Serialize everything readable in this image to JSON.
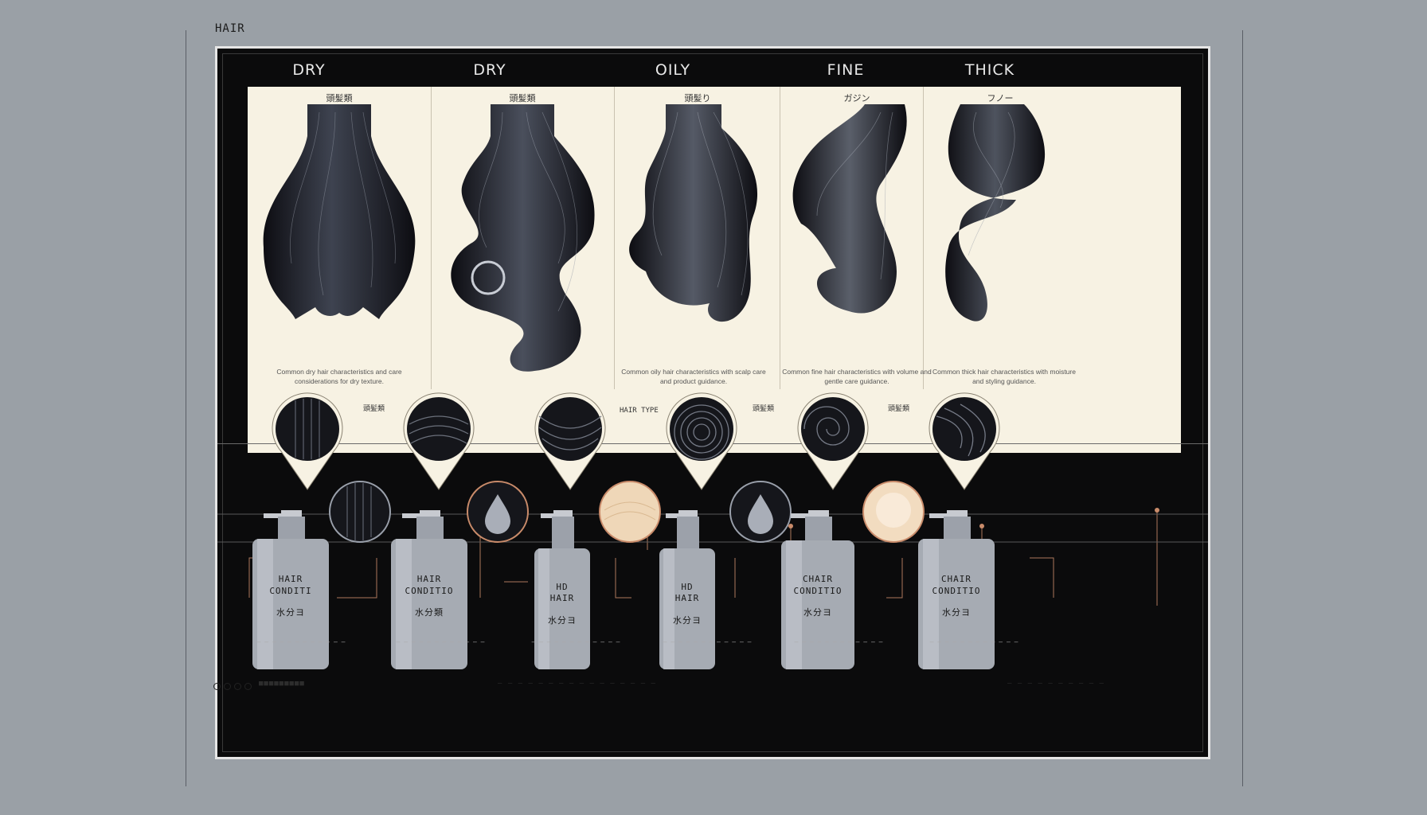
{
  "header": {
    "corner_tag": "HAIR"
  },
  "types": [
    {
      "title": "DRY",
      "sublabel": "頭髪類",
      "desc": "Common dry hair characteristics and care considerations for dry texture."
    },
    {
      "title": "DRY",
      "sublabel": "頭髪類",
      "desc": ""
    },
    {
      "title": "OILY",
      "sublabel": "頭髪り",
      "desc": "Common oily hair characteristics with scalp care and product guidance."
    },
    {
      "title": "FINE",
      "sublabel": "ガジン",
      "desc": "Common fine hair characteristics with volume and gentle care guidance."
    },
    {
      "title": "THICK",
      "sublabel": "フノー",
      "desc": "Common thick hair characteristics with moisture and styling guidance."
    }
  ],
  "swatch_labels": [
    "頭髪類",
    "HAIR TYPE",
    "頭髪類",
    "頭髪類"
  ],
  "bottles": [
    {
      "line1": "HAIR",
      "line2": "CONDITI",
      "line3": "水分ヨ"
    },
    {
      "line1": "HAIR",
      "line2": "CONDITIO",
      "line3": "水分類"
    },
    {
      "line1": "HD",
      "line2": "HAIR",
      "line3": "水分ヨ"
    },
    {
      "line1": "HD",
      "line2": "HAIR",
      "line3": "水分ヨ"
    },
    {
      "line1": "CHAIR",
      "line2": "CONDITIO",
      "line3": "水分ヨ"
    },
    {
      "line1": "CHAIR",
      "line2": "CONDITIO",
      "line3": "水分ヨ"
    }
  ],
  "footnote": "— — — — — — — — — — — —",
  "footer": {
    "left": "■■■■■■■■■",
    "center": "— — — — — — — — — — — — — — — —",
    "right": "— — — — — — — — — —"
  },
  "colors": {
    "panel": "#f7f2e3",
    "poster": "#0b0b0c",
    "bg": "#9aa0a6",
    "copper": "#c98b6a"
  }
}
